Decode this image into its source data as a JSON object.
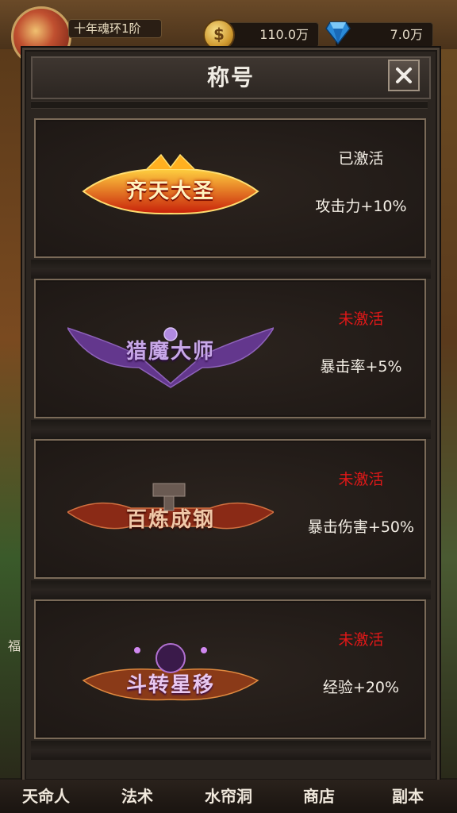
{
  "topbar": {
    "rank_label": "十年魂环1阶",
    "gold_amount": "110.0万",
    "gem_amount": "7.0万",
    "coin_symbol": "$"
  },
  "panel": {
    "title": "称号",
    "close_glyph": "✕"
  },
  "titles": [
    {
      "badge_text": "齐天大圣",
      "status": "已激活",
      "bonus": "攻击力+10%",
      "activated": true
    },
    {
      "badge_text": "猎魔大师",
      "status": "未激活",
      "bonus": "暴击率+5%",
      "activated": false
    },
    {
      "badge_text": "百炼成钢",
      "status": "未激活",
      "bonus": "暴击伤害+50%",
      "activated": false
    },
    {
      "badge_text": "斗转星移",
      "status": "未激活",
      "bonus": "经验+20%",
      "activated": false
    }
  ],
  "background": {
    "side_text": "福"
  },
  "bottom_nav": [
    {
      "label": "天命人"
    },
    {
      "label": "法术"
    },
    {
      "label": "水帘洞"
    },
    {
      "label": "商店"
    },
    {
      "label": "副本"
    }
  ],
  "colors": {
    "active_text": "#f4efe6",
    "inactive_text": "#e01818"
  }
}
